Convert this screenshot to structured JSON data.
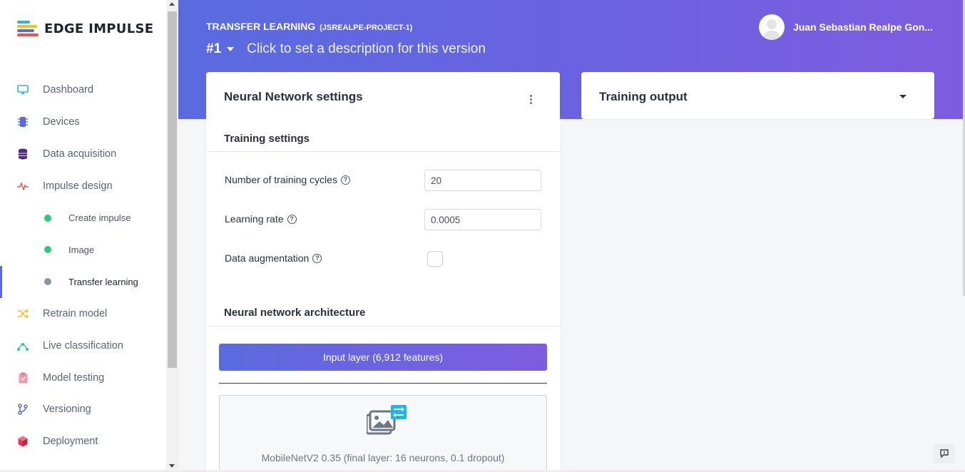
{
  "brand": {
    "name": "EDGE IMPULSE"
  },
  "sidebar": {
    "items": [
      {
        "label": "Dashboard",
        "icon": "monitor-icon",
        "color": "#36b3d6"
      },
      {
        "label": "Devices",
        "icon": "chip-icon",
        "color": "#5b6bde"
      },
      {
        "label": "Data acquisition",
        "icon": "database-icon",
        "color": "#4b2a8a"
      },
      {
        "label": "Impulse design",
        "icon": "pulse-icon",
        "color": "#e8564e"
      },
      {
        "label": "Create impulse",
        "icon": "dot-icon",
        "color": "#2ecc71"
      },
      {
        "label": "Image",
        "icon": "dot-icon",
        "color": "#2ecc71"
      },
      {
        "label": "Transfer learning",
        "icon": "dot-icon",
        "color": "#8a94a6"
      },
      {
        "label": "Retrain model",
        "icon": "shuffle-icon",
        "color": "#f1c21b"
      },
      {
        "label": "Live classification",
        "icon": "network-icon",
        "color": "#2ec4a3"
      },
      {
        "label": "Model testing",
        "icon": "clipboard-check-icon",
        "color": "#f19aa6"
      },
      {
        "label": "Versioning",
        "icon": "branch-icon",
        "color": "#5b6bde"
      },
      {
        "label": "Deployment",
        "icon": "box-icon",
        "color": "#e8364e"
      }
    ]
  },
  "header": {
    "title": "TRANSFER LEARNING",
    "project": "(JSREALPE-PROJECT-1)",
    "version": "#1",
    "description": "Click to set a description for this version",
    "user_name": "Juan Sebastian Realpe Gon..."
  },
  "nn_settings": {
    "title": "Neural Network settings",
    "training_settings_heading": "Training settings",
    "fields": [
      {
        "label": "Number of training cycles",
        "value": "20"
      },
      {
        "label": "Learning rate",
        "value": "0.0005"
      },
      {
        "label": "Data augmentation",
        "checked": false
      }
    ],
    "architecture_heading": "Neural network architecture",
    "input_layer": "Input layer (6,912 features)",
    "model": "MobileNetV2 0.35 (final layer: 16 neurons, 0.1 dropout)"
  },
  "training_output": {
    "title": "Training output"
  },
  "colors": {
    "accent_start": "#5a6be0",
    "accent_end": "#7e5ce0"
  }
}
